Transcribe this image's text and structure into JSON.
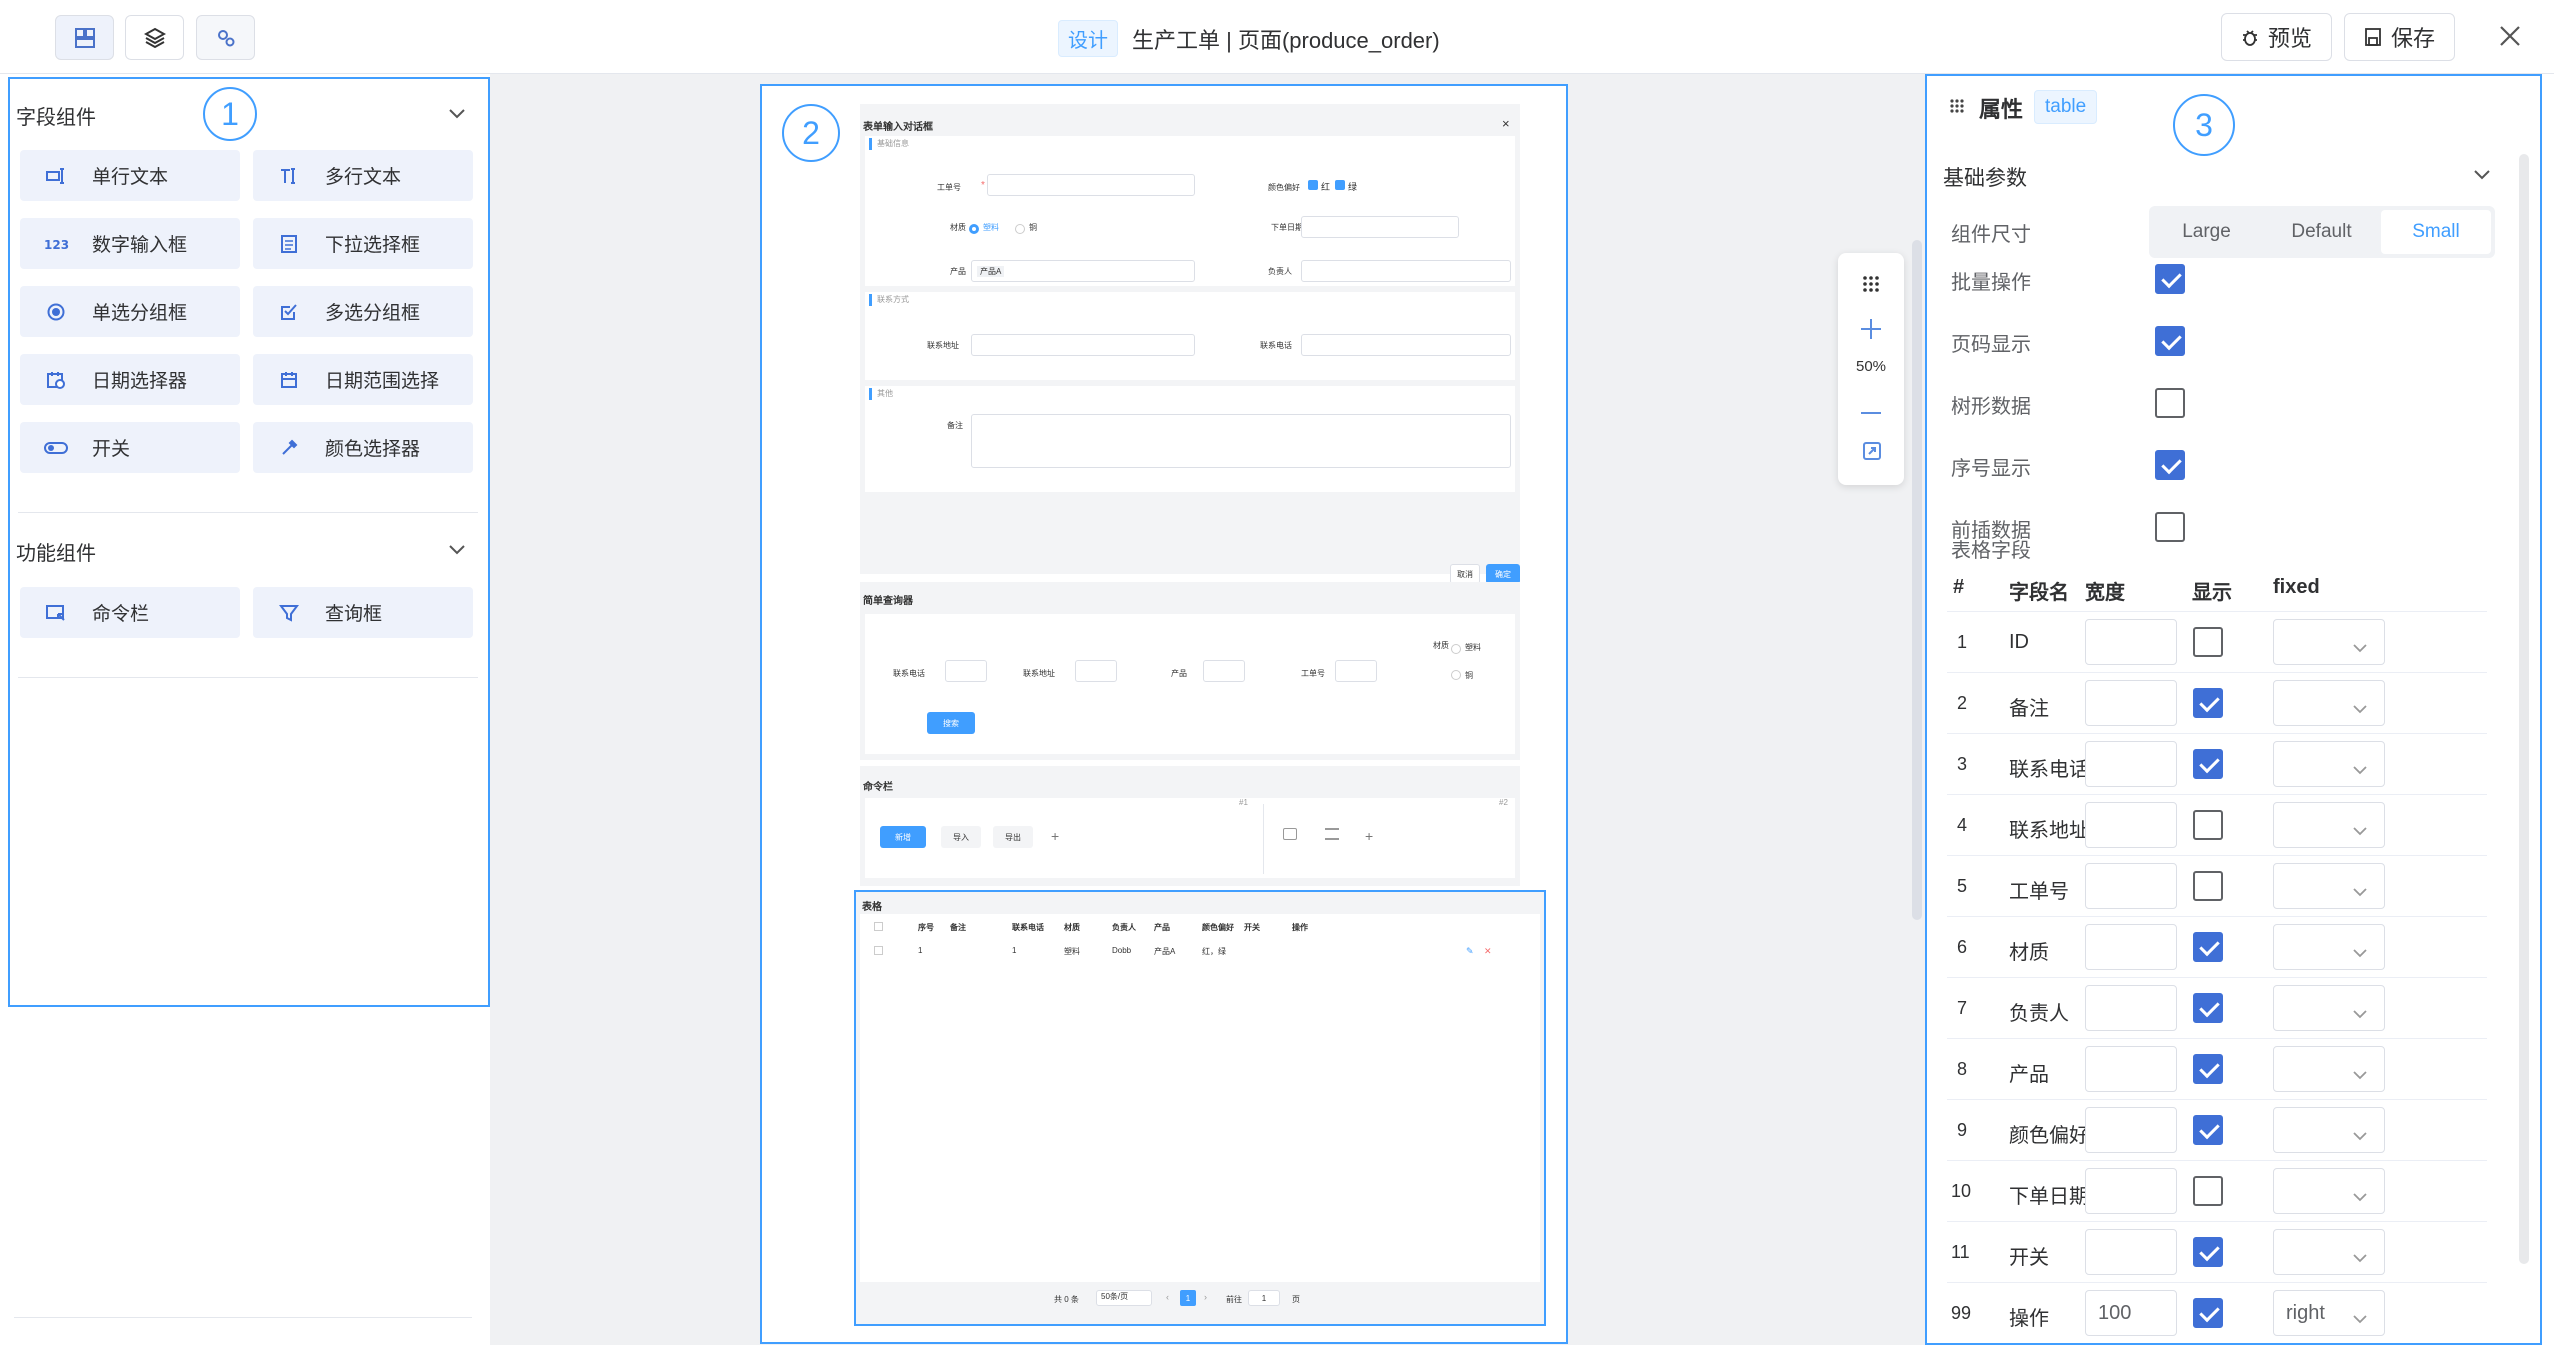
{
  "header": {
    "tag": "设计",
    "title": "生产工单 | 页面(produce_order)",
    "preview_label": "预览",
    "save_label": "保存"
  },
  "left_panel": {
    "marker": "1",
    "field_group_title": "字段组件",
    "field_components": [
      {
        "label": "单行文本",
        "icon": "single-line-text-icon"
      },
      {
        "label": "多行文本",
        "icon": "multi-line-text-icon"
      },
      {
        "label": "数字输入框",
        "icon": "number-input-icon"
      },
      {
        "label": "下拉选择框",
        "icon": "select-icon"
      },
      {
        "label": "单选分组框",
        "icon": "radio-icon"
      },
      {
        "label": "多选分组框",
        "icon": "checkbox-group-icon"
      },
      {
        "label": "日期选择器",
        "icon": "date-picker-icon"
      },
      {
        "label": "日期范围选择",
        "icon": "date-range-icon"
      },
      {
        "label": "开关",
        "icon": "switch-icon"
      },
      {
        "label": "颜色选择器",
        "icon": "color-picker-icon"
      }
    ],
    "func_group_title": "功能组件",
    "func_components": [
      {
        "label": "命令栏",
        "icon": "command-bar-icon"
      },
      {
        "label": "查询框",
        "icon": "filter-icon"
      }
    ]
  },
  "center": {
    "marker": "2",
    "dialog": {
      "title": "表单输入对话框",
      "close": "×",
      "section1": "基础信息",
      "f_order_no": "工单号",
      "f_color": "颜色偏好",
      "color_opts": [
        "红",
        "绿"
      ],
      "f_material": "材质",
      "material_opts": [
        "塑料",
        "铜"
      ],
      "f_date": "下单日期",
      "f_product": "产品",
      "product_tag": "产品A",
      "f_owner": "负责人",
      "section2": "联系方式",
      "f_address": "联系地址",
      "f_phone": "联系电话",
      "section3": "其他",
      "f_remark": "备注",
      "cancel": "取消",
      "ok": "确定"
    },
    "query": {
      "title": "简单查询器",
      "f_phone": "联系电话",
      "f_address": "联系地址",
      "f_product": "产品",
      "f_order": "工单号",
      "f_material": "材质",
      "material_opts": [
        "塑料",
        "铜"
      ],
      "search": "搜索"
    },
    "cmdbar": {
      "title": "命令栏",
      "tag1": "#1",
      "tag2": "#2",
      "new": "新增",
      "import": "导入",
      "export": "导出",
      "plus": "+"
    },
    "table": {
      "title": "表格",
      "headers": [
        "序号",
        "备注",
        "联系电话",
        "材质",
        "负责人",
        "产品",
        "颜色偏好",
        "开关",
        "操作"
      ],
      "row": [
        "1",
        "",
        "1",
        "塑料",
        "Dobb",
        "产品A",
        "红，绿",
        "",
        ""
      ],
      "total": "共 0 条",
      "page_size": "50条/页",
      "page": "1",
      "goto": "前往",
      "goto_val": "1",
      "page_unit": "页"
    }
  },
  "zoom": {
    "level": "50%"
  },
  "right_panel": {
    "marker": "3",
    "title": "属性",
    "tag": "table",
    "section": "基础参数",
    "size_label": "组件尺寸",
    "sizes": [
      "Large",
      "Default",
      "Small"
    ],
    "selected_size": "Small",
    "options": [
      {
        "label": "批量操作",
        "checked": true
      },
      {
        "label": "页码显示",
        "checked": true
      },
      {
        "label": "树形数据",
        "checked": false
      },
      {
        "label": "序号显示",
        "checked": true
      },
      {
        "label": "前插数据",
        "checked": false
      }
    ],
    "fields_label": "表格字段",
    "columns": [
      "#",
      "字段名",
      "宽度",
      "显示",
      "fixed"
    ],
    "rows": [
      {
        "no": "1",
        "name": "ID",
        "width": "",
        "show": false,
        "fixed": ""
      },
      {
        "no": "2",
        "name": "备注",
        "width": "",
        "show": true,
        "fixed": ""
      },
      {
        "no": "3",
        "name": "联系电话",
        "width": "",
        "show": true,
        "fixed": ""
      },
      {
        "no": "4",
        "name": "联系地址",
        "width": "",
        "show": false,
        "fixed": ""
      },
      {
        "no": "5",
        "name": "工单号",
        "width": "",
        "show": false,
        "fixed": ""
      },
      {
        "no": "6",
        "name": "材质",
        "width": "",
        "show": true,
        "fixed": ""
      },
      {
        "no": "7",
        "name": "负责人",
        "width": "",
        "show": true,
        "fixed": ""
      },
      {
        "no": "8",
        "name": "产品",
        "width": "",
        "show": true,
        "fixed": ""
      },
      {
        "no": "9",
        "name": "颜色偏好",
        "width": "",
        "show": true,
        "fixed": ""
      },
      {
        "no": "10",
        "name": "下单日期",
        "width": "",
        "show": false,
        "fixed": ""
      },
      {
        "no": "11",
        "name": "开关",
        "width": "",
        "show": true,
        "fixed": ""
      },
      {
        "no": "99",
        "name": "操作",
        "width": "100",
        "show": true,
        "fixed": "right"
      }
    ]
  },
  "colors": {
    "accent": "#409eff",
    "checkbox": "#3f6fd6",
    "component_bg": "#eef2fb"
  }
}
